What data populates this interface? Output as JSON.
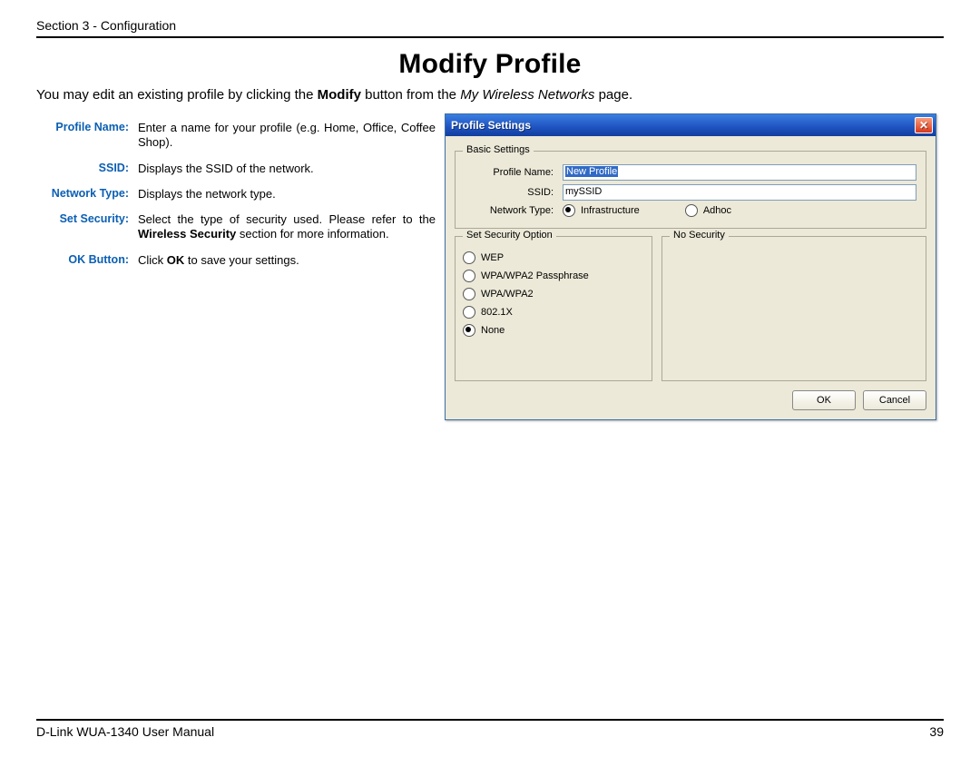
{
  "header": "Section 3 - Configuration",
  "title": "Modify Profile",
  "intro_parts": {
    "p1": "You may edit an existing profile by clicking the ",
    "b1": "Modify",
    "p2": " button from the ",
    "i1": "My Wireless Networks",
    "p3": " page."
  },
  "definitions": {
    "profile_name": {
      "label": "Profile Name:",
      "text": "Enter a name for your profile (e.g. Home, Office, Coffee Shop)."
    },
    "ssid": {
      "label": "SSID:",
      "text": "Displays the SSID of the network."
    },
    "network_type": {
      "label": "Network Type:",
      "text": "Displays the network type."
    },
    "set_security": {
      "label": "Set Security:",
      "t1": "Select the type of security used. Please refer to the ",
      "b1": "Wireless Security",
      "t2": " section for more information."
    },
    "ok_button": {
      "label": "OK Button:",
      "t1": "Click ",
      "b1": "OK",
      "t2": " to save your settings."
    }
  },
  "dialog": {
    "title": "Profile Settings",
    "basic": {
      "legend": "Basic Settings",
      "profile_name_label": "Profile Name:",
      "profile_name_value": "New Profile",
      "ssid_label": "SSID:",
      "ssid_value": "mySSID",
      "network_type_label": "Network Type:",
      "infrastructure": "Infrastructure",
      "adhoc": "Adhoc"
    },
    "security": {
      "legend": "Set Security Option",
      "wep": "WEP",
      "wpa_pass": "WPA/WPA2 Passphrase",
      "wpa": "WPA/WPA2",
      "8021x": "802.1X",
      "none": "None"
    },
    "nosecurity_legend": "No Security",
    "ok": "OK",
    "cancel": "Cancel"
  },
  "footer": {
    "left": "D-Link WUA-1340 User Manual",
    "right": "39"
  }
}
